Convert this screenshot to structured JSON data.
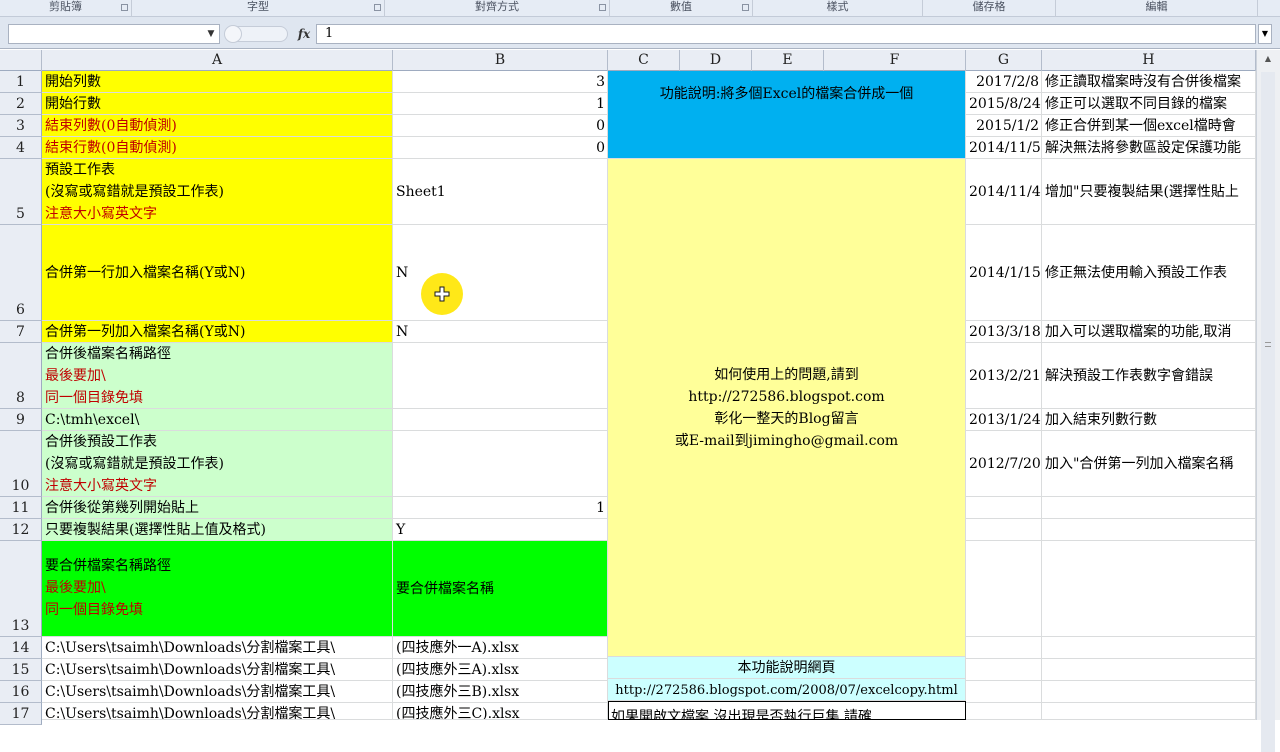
{
  "ribbon": {
    "groups": [
      "剪貼簿",
      "字型",
      "對齊方式",
      "數值",
      "樣式",
      "儲存格",
      "編輯"
    ]
  },
  "formula_bar": {
    "name_box": "",
    "fx_label": "fx",
    "content": "1"
  },
  "columns": [
    "A",
    "B",
    "C",
    "D",
    "E",
    "F",
    "G",
    "H"
  ],
  "rows": [
    "1",
    "2",
    "3",
    "4",
    "5",
    "6",
    "7",
    "8",
    "9",
    "10",
    "11",
    "12",
    "13",
    "14",
    "15",
    "16",
    "17"
  ],
  "colors": {
    "yellow": "#ffff00",
    "light_green": "#ccffcc",
    "green": "#00ff00",
    "cyan": "#00b0f0",
    "light_yellow": "#ffff99",
    "light_cyan": "#ccffff",
    "red_text": "#c00000"
  },
  "cells": {
    "A1": "開始列數",
    "B1": "3",
    "A2": "開始行數",
    "B2": "1",
    "A3": "結束列數(0自動偵測)",
    "B3": "0",
    "A4": "結束行數(0自動偵測)",
    "B4": "0",
    "A5": [
      "預設工作表",
      "(沒寫或寫錯就是預設工作表)",
      "注意大小寫英文字"
    ],
    "B5": "Sheet1",
    "A6": "合併第一行加入檔案名稱(Y或N)",
    "B6": "N",
    "A7": "合併第一列加入檔案名稱(Y或N)",
    "B7": "N",
    "A8": [
      "合併後檔案名稱路徑",
      "最後要加\\",
      "同一個目錄免填"
    ],
    "A9": "C:\\tmh\\excel\\",
    "A10": [
      "合併後預設工作表",
      "(沒寫或寫錯就是預設工作表)",
      "注意大小寫英文字"
    ],
    "A11": "合併後從第幾列開始貼上",
    "B11": "1",
    "A12": "只要複製結果(選擇性貼上值及格式)",
    "B12": "Y",
    "A13": [
      "要合併檔案名稱路徑",
      "最後要加\\",
      "同一個目錄免填"
    ],
    "B13": "要合併檔案名稱",
    "A14": "C:\\Users\\tsaimh\\Downloads\\分割檔案工具\\",
    "B14": "(四技應外一A).xlsx",
    "A15": "C:\\Users\\tsaimh\\Downloads\\分割檔案工具\\",
    "B15": "(四技應外三A).xlsx",
    "A16": "C:\\Users\\tsaimh\\Downloads\\分割檔案工具\\",
    "B16": "(四技應外三B).xlsx",
    "A17": "C:\\Users\\tsaimh\\Downloads\\分割檔案工具\\",
    "B17": "(四技應外三C).xlsx",
    "C1_title": "功能說明:將多個Excel的檔案合併成一個",
    "C5_help": [
      "如何使用上的問題,請到",
      "http://272586.blogspot.com",
      "彰化一整天的Blog留言",
      "或E-mail到jimingho@gmail.com"
    ],
    "C15_title": "本功能說明網頁",
    "C16_url": "http://272586.blogspot.com/2008/07/excelcopy.html",
    "C17_partial": "如果開啟文檔案,沒出現是否執行巨集,請確"
  },
  "changelog": [
    {
      "date": "2017/2/8",
      "note": "修正讀取檔案時沒有合併後檔案"
    },
    {
      "date": "2015/8/24",
      "note": "修正可以選取不同目錄的檔案"
    },
    {
      "date": "2015/1/2",
      "note": "修正合併到某一個excel檔時會"
    },
    {
      "date": "2014/11/5",
      "note": "解決無法將參數區設定保護功能"
    },
    {
      "date": "2014/11/4",
      "note": "增加\"只要複製結果(選擇性貼上"
    },
    {
      "date": "2014/1/15",
      "note": "修正無法使用輸入預設工作表"
    },
    {
      "date": "2013/3/18",
      "note": "加入可以選取檔案的功能,取消"
    },
    {
      "date": "2013/2/21",
      "note": "解決預設工作表數字會錯誤"
    },
    {
      "date": "2013/1/24",
      "note": "加入結束列數行數"
    },
    {
      "date": "2012/7/20",
      "note": "加入\"合併第一列加入檔案名稱"
    }
  ]
}
